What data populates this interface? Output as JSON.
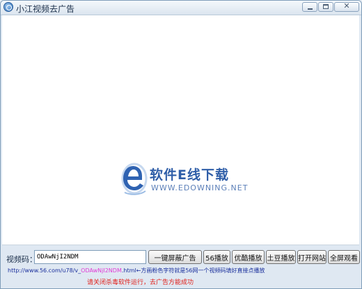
{
  "window": {
    "title": "小江视频去广告"
  },
  "titlebar_buttons": {
    "close_glyph": "✕"
  },
  "watermark": {
    "name": "软件E线下载",
    "url": "WWW.EDOWNING.NET"
  },
  "controls": {
    "code_label": "视频码：",
    "code_value": "ODAwNjI2NDM",
    "buttons": {
      "block_ads": "一键屏蔽广告",
      "play_56": "56播放",
      "play_youku": "优酷播放",
      "play_tudou": "土豆播放",
      "open_site": "打开网站",
      "fullscreen": "全屏观看"
    }
  },
  "hint": {
    "url_prefix": "http://www.56.com/u78/v_",
    "url_code": "ODAwNjI2NDM",
    "url_suffix": ".html",
    "description": "←方画粉色字符就是56网一个视频码填好直接点播放"
  },
  "warning": "请关闭杀毒软件运行，去广告方能成功",
  "colors": {
    "hint_url": "#1a2f9c",
    "hint_code": "#e23ad6",
    "warning": "#e0201a"
  }
}
